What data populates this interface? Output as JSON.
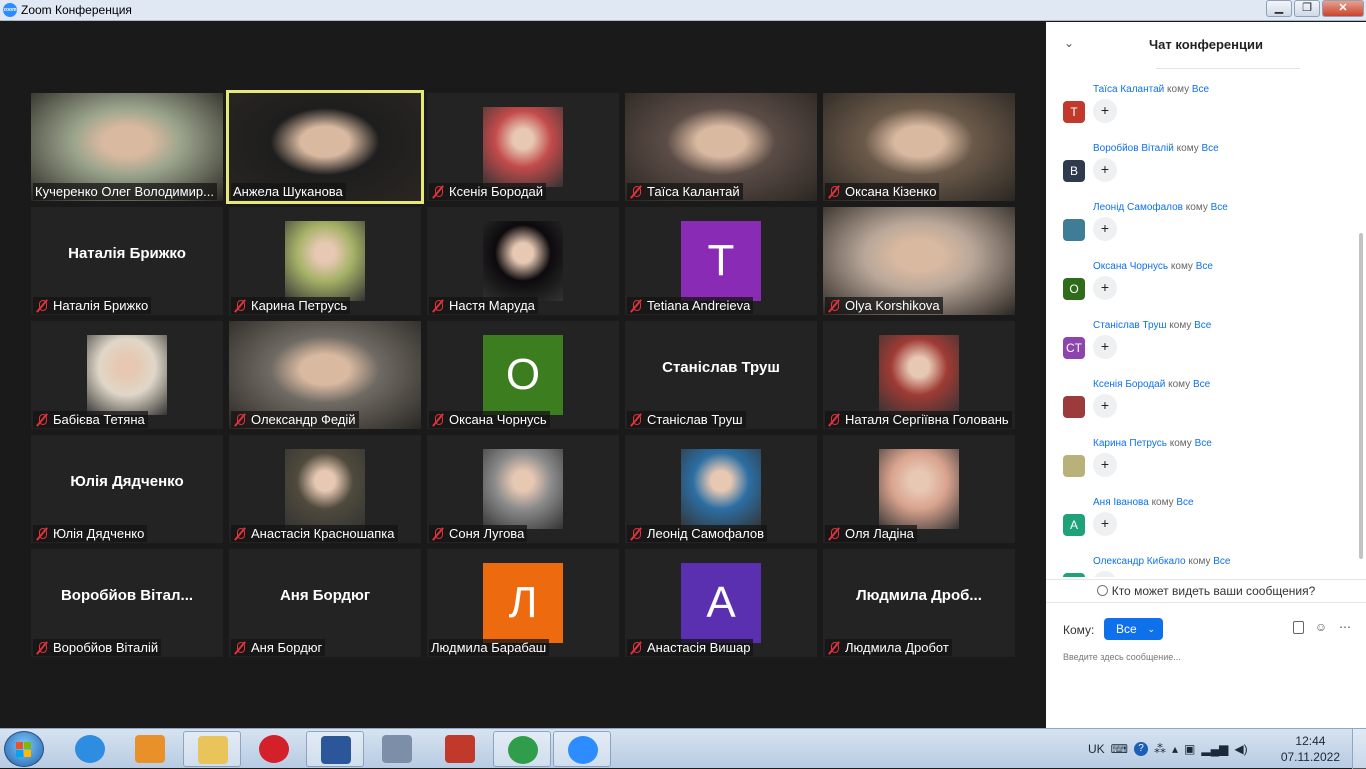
{
  "window": {
    "title": "Zoom Конференция"
  },
  "gallery": {
    "tiles": [
      {
        "name": "Кучеренко Олег Володимир...",
        "muted": false,
        "kind": "video",
        "bg": "#9aa48c"
      },
      {
        "name": "Анжела Шуканова",
        "muted": false,
        "kind": "video",
        "bg": "#1e1e1e",
        "active": true
      },
      {
        "name": "Ксенія Бородай",
        "muted": true,
        "kind": "avatar",
        "bg": "#c34b4b"
      },
      {
        "name": "Таїса Калантай",
        "muted": true,
        "kind": "video",
        "bg": "#5b4c46"
      },
      {
        "name": "Оксана Кізенко",
        "muted": true,
        "kind": "video",
        "bg": "#6b5a4a"
      },
      {
        "name": "Наталія Брижко",
        "muted": true,
        "kind": "text",
        "big": "Наталія Брижко"
      },
      {
        "name": "Карина Петрусь",
        "muted": true,
        "kind": "avatar",
        "bg": "#a6b267"
      },
      {
        "name": "Настя Маруда",
        "muted": true,
        "kind": "avatar",
        "bg": "#0c0a0c"
      },
      {
        "name": "Tetiana Andreieva",
        "muted": true,
        "kind": "letter",
        "letter": "T",
        "bg": "#8a2bb5"
      },
      {
        "name": "Olya Korshikova",
        "muted": true,
        "kind": "video",
        "bg": "#b9a799"
      },
      {
        "name": "Бабієва Тетяна",
        "muted": true,
        "kind": "avatar",
        "bg": "#e0d7c8"
      },
      {
        "name": "Олександр Федій",
        "muted": true,
        "kind": "video",
        "bg": "#6f6a63"
      },
      {
        "name": "Оксана Чорнусь",
        "muted": true,
        "kind": "letter",
        "letter": "O",
        "bg": "#3c7d1f"
      },
      {
        "name": "Станіслав Труш",
        "muted": true,
        "kind": "text",
        "big": "Станіслав Труш"
      },
      {
        "name": "Наталя Сергіївна Головань",
        "muted": true,
        "kind": "avatar",
        "bg": "#9f3b35"
      },
      {
        "name": "Юлія Дядченко",
        "muted": true,
        "kind": "text",
        "big": "Юлія Дядченко"
      },
      {
        "name": "Анастасія Красношапка",
        "muted": true,
        "kind": "avatar",
        "bg": "#4f4a3c"
      },
      {
        "name": "Соня Лугова",
        "muted": true,
        "kind": "avatar",
        "bg": "#8c8c8c"
      },
      {
        "name": "Леонід Самофалов",
        "muted": true,
        "kind": "avatar",
        "bg": "#2c6ea3"
      },
      {
        "name": "Оля Ладіна",
        "muted": true,
        "kind": "avatar",
        "bg": "#d9a38e"
      },
      {
        "name": "Воробйов Віталій",
        "muted": true,
        "kind": "text",
        "big": "Воробйов Вітал..."
      },
      {
        "name": "Аня Бордюг",
        "muted": true,
        "kind": "text",
        "big": "Аня Бордюг"
      },
      {
        "name": "Людмила Барабаш",
        "muted": false,
        "kind": "letter",
        "letter": "Л",
        "bg": "#ee6a0e"
      },
      {
        "name": "Анастасія Вишар",
        "muted": true,
        "kind": "letter",
        "letter": "A",
        "bg": "#5a2fb0"
      },
      {
        "name": "Людмила Дробот",
        "muted": true,
        "kind": "text",
        "big": "Людмила Дроб..."
      }
    ]
  },
  "chat": {
    "title": "Чат конференции",
    "to_word": "кому",
    "messages": [
      {
        "sender": "Таїса Калантай",
        "target": "Все",
        "avatar": "T",
        "avatar_color": "#c0392b"
      },
      {
        "sender": "Воробйов Віталій",
        "target": "Все",
        "avatar": "B",
        "avatar_color": "#2f3b4c"
      },
      {
        "sender": "Леонід Самофалов",
        "target": "Все",
        "avatar": "",
        "avatar_color": "#3f7d96"
      },
      {
        "sender": "Оксана Чорнусь",
        "target": "Все",
        "avatar": "O",
        "avatar_color": "#2e6b1a"
      },
      {
        "sender": "Станіслав Труш",
        "target": "Все",
        "avatar": "CT",
        "avatar_color": "#8e44ad"
      },
      {
        "sender": "Ксенія Бородай",
        "target": "Все",
        "avatar": "",
        "avatar_color": "#9b3b3b"
      },
      {
        "sender": "Карина Петрусь",
        "target": "Все",
        "avatar": "",
        "avatar_color": "#b8b27a"
      },
      {
        "sender": "Аня Іванова",
        "target": "Все",
        "avatar": "A",
        "avatar_color": "#1fa27a"
      },
      {
        "sender": "Олександр Кибкало",
        "target": "Все",
        "avatar": "O",
        "avatar_color": "#1fa27a"
      }
    ],
    "reaction_label": "+",
    "who_sees": "Кто может видеть ваши сообщения?",
    "to_label": "Кому:",
    "to_value": "Все",
    "input_placeholder": "Введите здесь сообщение..."
  },
  "taskbar": {
    "language": "UK",
    "time": "12:44",
    "date": "07.11.2022",
    "apps": [
      {
        "name": "internet-explorer",
        "color": "#2e8de0",
        "pinned": false
      },
      {
        "name": "media-player",
        "color": "#e8902a",
        "pinned": false
      },
      {
        "name": "file-explorer",
        "color": "#e8c45a",
        "pinned": true
      },
      {
        "name": "opera",
        "color": "#d3202a",
        "pinned": false
      },
      {
        "name": "word",
        "color": "#2b579a",
        "pinned": true
      },
      {
        "name": "calculator",
        "color": "#7d8ea8",
        "pinned": false
      },
      {
        "name": "paint-app",
        "color": "#c0392b",
        "pinned": false
      },
      {
        "name": "chrome",
        "color": "#2f9d4a",
        "pinned": true
      },
      {
        "name": "zoom",
        "color": "#2d8cff",
        "pinned": true
      }
    ]
  }
}
